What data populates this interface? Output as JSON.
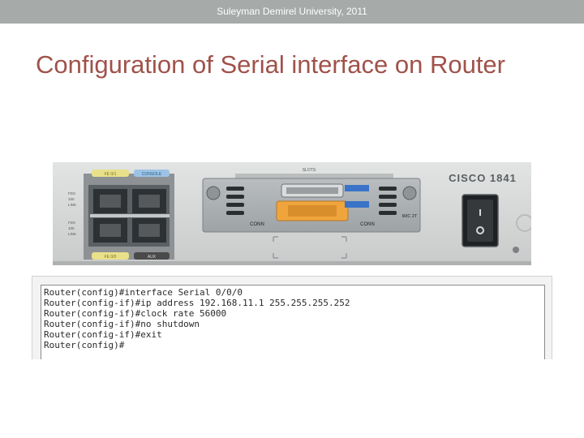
{
  "header": {
    "text": "Suleyman Demirel University, 2011"
  },
  "title": "Configuration of Serial interface on Router",
  "router_image": {
    "brand_label": "CISCO 1841",
    "slot_label": "SLOTS",
    "port_labels": [
      "FE 0/1",
      "CONSOLE",
      "FE 0/0",
      "AUX"
    ],
    "conn_labels": [
      "CONN",
      "CONN"
    ],
    "wic_label": "WIC 2T",
    "side_labels": [
      "FDX",
      "100",
      "LINK",
      "FDX",
      "100",
      "LINK"
    ],
    "colors": {
      "chassis": "#d4d6d6",
      "yellow_tag": "#e9e08a",
      "blue_tag": "#9cc3e6",
      "dark_tag": "#4a4a4a",
      "orange_connector": "#f0a53c",
      "blue_connector": "#3a73c8"
    }
  },
  "cli": {
    "lines": [
      "Router(config)#interface Serial 0/0/0",
      "Router(config-if)#ip address 192.168.11.1 255.255.255.252",
      "Router(config-if)#clock rate 56000",
      "Router(config-if)#no shutdown",
      "Router(config-if)#exit",
      "Router(config)#"
    ]
  }
}
